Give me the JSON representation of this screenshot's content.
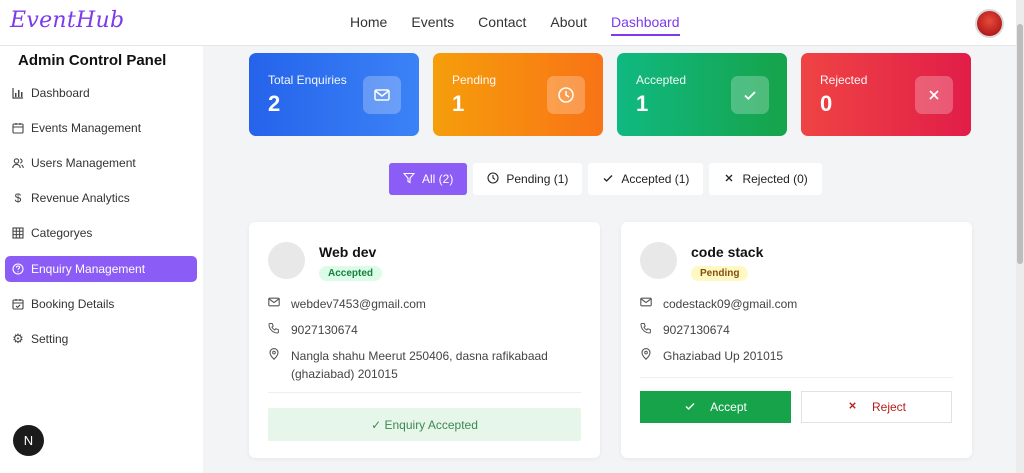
{
  "brand": {
    "logo": "EventHub"
  },
  "nav": {
    "items": [
      "Home",
      "Events",
      "Contact",
      "About",
      "Dashboard"
    ],
    "active": "Dashboard"
  },
  "sidebar": {
    "title": "Admin Control Panel",
    "items": [
      {
        "label": "Dashboard",
        "icon": "bar-chart-icon"
      },
      {
        "label": "Events Management",
        "icon": "calendar-icon"
      },
      {
        "label": "Users Management",
        "icon": "users-icon"
      },
      {
        "label": "Revenue Analytics",
        "icon": "dollar-icon"
      },
      {
        "label": "Categoryes",
        "icon": "grid-icon"
      },
      {
        "label": "Enquiry Management",
        "icon": "help-icon"
      },
      {
        "label": "Booking Details",
        "icon": "calendar-check-icon"
      },
      {
        "label": "Setting",
        "icon": "gear-icon"
      }
    ],
    "active": "Enquiry Management",
    "badge": "N"
  },
  "stats": [
    {
      "label": "Total Enquiries",
      "value": "2",
      "icon": "mail-icon",
      "color_from": "#2563eb",
      "color_to": "#3b82f6"
    },
    {
      "label": "Pending",
      "value": "1",
      "icon": "clock-icon",
      "color_from": "#f59e0b",
      "color_to": "#f97316"
    },
    {
      "label": "Accepted",
      "value": "1",
      "icon": "check-icon",
      "color_from": "#10b981",
      "color_to": "#16a34a"
    },
    {
      "label": "Rejected",
      "value": "0",
      "icon": "x-icon",
      "color_from": "#ef4444",
      "color_to": "#e11d48"
    }
  ],
  "filters": [
    {
      "label": "All (2)",
      "icon": "filter-icon",
      "active": true
    },
    {
      "label": "Pending (1)",
      "icon": "clock-icon",
      "active": false
    },
    {
      "label": "Accepted (1)",
      "icon": "check-icon",
      "active": false
    },
    {
      "label": "Rejected (0)",
      "icon": "x-icon",
      "active": false
    }
  ],
  "enquiries": [
    {
      "name": "Web dev",
      "status": "Accepted",
      "email": "webdev7453@gmail.com",
      "phone": "9027130674",
      "address_line1": "Nangla shahu Meerut 250406, dasna rafikabaad",
      "address_line2": "(ghaziabad) 201015",
      "accepted_text": "✓ Enquiry Accepted"
    },
    {
      "name": "code stack",
      "status": "Pending",
      "email": "codestack09@gmail.com",
      "phone": "9027130674",
      "address_line1": "Ghaziabad Up 201015",
      "accept_label": "Accept",
      "reject_label": "Reject"
    }
  ],
  "colors": {
    "accent": "#8b5cf6",
    "accept": "#16a34a",
    "reject": "#b91c1c"
  }
}
